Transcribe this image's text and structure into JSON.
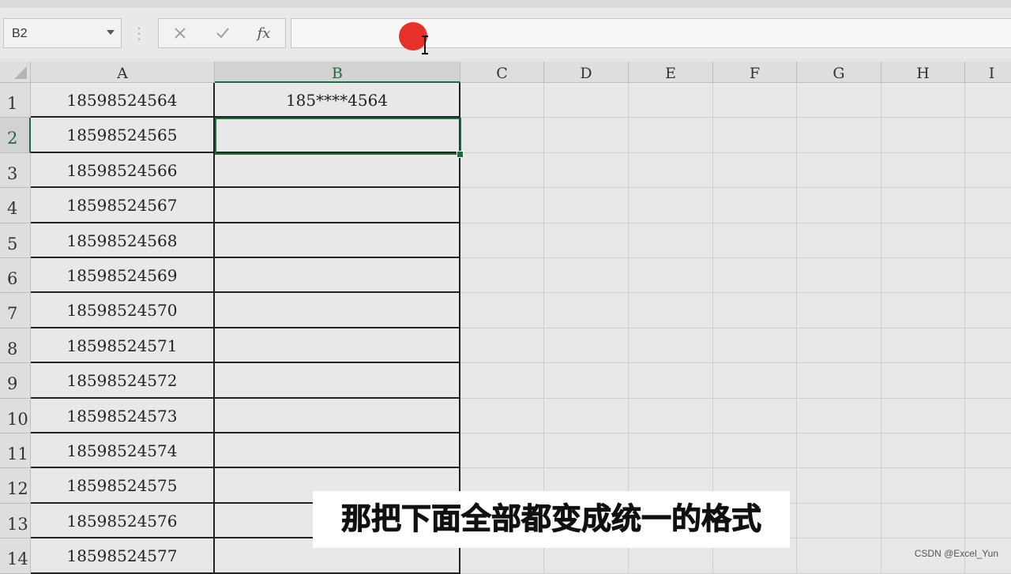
{
  "formula_bar": {
    "name_box_value": "B2",
    "cancel_icon": "close-icon",
    "enter_icon": "check-icon",
    "function_label": "fx",
    "formula_value": ""
  },
  "columns": [
    "A",
    "B",
    "C",
    "D",
    "E",
    "F",
    "G",
    "H",
    "I"
  ],
  "rows": [
    "1",
    "2",
    "3",
    "4",
    "5",
    "6",
    "7",
    "8",
    "9",
    "10",
    "11",
    "12",
    "13",
    "14"
  ],
  "col_a_values": [
    "18598524564",
    "18598524565",
    "18598524566",
    "18598524567",
    "18598524568",
    "18598524569",
    "18598524570",
    "18598524571",
    "18598524572",
    "18598524573",
    "18598524574",
    "18598524575",
    "18598524576",
    "18598524577"
  ],
  "col_b_values": [
    "185****4564",
    "",
    "",
    "",
    "",
    "",
    "",
    "",
    "",
    "",
    "",
    "",
    "",
    ""
  ],
  "selected_cell": "B2",
  "subtitle_text": "那把下面全部都变成统一的格式",
  "watermark": "CSDN @Excel_Yun",
  "colors": {
    "selection_green": "#1e6b3c",
    "cursor_dot": "#e8302a"
  }
}
